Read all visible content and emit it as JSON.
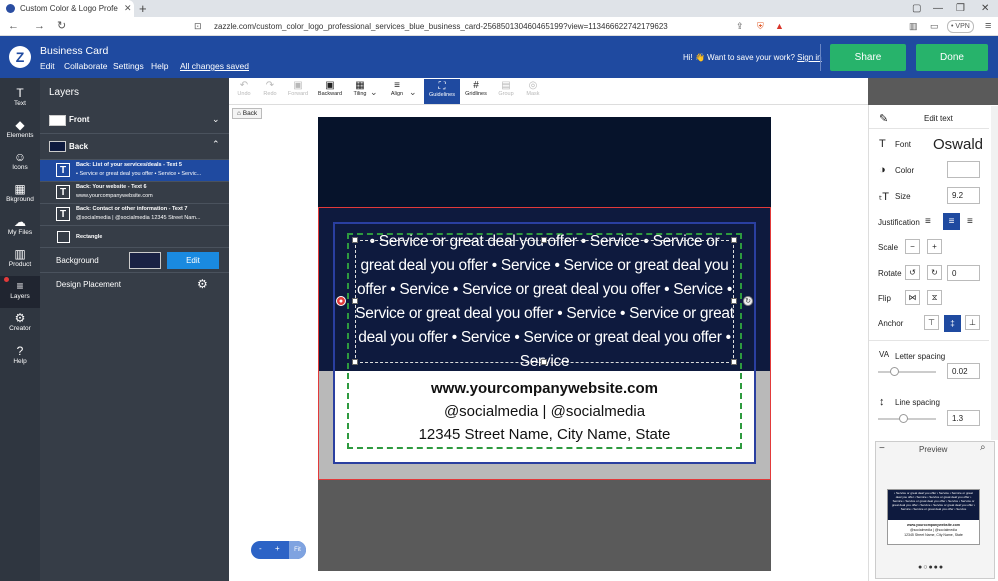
{
  "browser": {
    "tab_title": "Custom Color & Logo Professio...",
    "url": "zazzle.com/custom_color_logo_professional_services_blue_business_card-256850130460465199?view=113466622742179623",
    "vpn": "VPN"
  },
  "header": {
    "title": "Business Card",
    "menu": [
      "Edit",
      "Collaborate",
      "Settings",
      "Help"
    ],
    "saved": "All changes saved",
    "save_prompt": "Hi! 👋 Want to save your work?",
    "sign_in": "Sign in",
    "share": "Share",
    "done": "Done"
  },
  "rail": [
    {
      "label": "Text",
      "icon": "T"
    },
    {
      "label": "Elements",
      "icon": "◆"
    },
    {
      "label": "Icons",
      "icon": "☺"
    },
    {
      "label": "Bkground",
      "icon": "▦"
    },
    {
      "label": "My Files",
      "icon": "☁"
    },
    {
      "label": "Product",
      "icon": "▥"
    },
    {
      "label": "Layers",
      "icon": "≡"
    },
    {
      "label": "Creator",
      "icon": "⚙"
    },
    {
      "label": "Help",
      "icon": "?"
    }
  ],
  "layers": {
    "title": "Layers",
    "front": "Front",
    "back": "Back",
    "items": [
      {
        "title": "Back: List of your services/deals - Text 5",
        "sub": "• Service or great deal you offer • Service • Servic..."
      },
      {
        "title": "Back: Your website - Text 6",
        "sub": "www.yourcompanywebsite.com"
      },
      {
        "title": "Back: Contact or other information - Text 7",
        "sub": "@socialmedia | @socialmedia 12345 Street Nam..."
      },
      {
        "title": "Rectangle",
        "sub": ""
      }
    ],
    "background_label": "Background",
    "edit": "Edit",
    "design_placement": "Design Placement"
  },
  "toolbar": [
    {
      "label": "Undo",
      "icon": "↶",
      "disabled": true
    },
    {
      "label": "Redo",
      "icon": "↷",
      "disabled": true
    },
    {
      "label": "Forward",
      "icon": "▣",
      "disabled": true
    },
    {
      "label": "Backward",
      "icon": "▣",
      "disabled": false
    },
    {
      "label": "Tiling",
      "icon": "▦",
      "disabled": false
    },
    {
      "label": "Align",
      "icon": "≡",
      "disabled": false
    },
    {
      "label": "Guidelines",
      "icon": "⛶",
      "disabled": false
    },
    {
      "label": "Gridlines",
      "icon": "#",
      "disabled": false
    },
    {
      "label": "Group",
      "icon": "▤",
      "disabled": true
    },
    {
      "label": "Mask",
      "icon": "◎",
      "disabled": true
    }
  ],
  "back_button": "Back",
  "card": {
    "services": "• Service or great deal you offer • Service • Service or great deal you offer • Service • Service or great deal you offer • Service • Service or great deal you offer • Service • Service or great deal you offer • Service • Service or great deal you offer • Service • Service or great deal you offer • Service",
    "website": "www.yourcompanywebsite.com",
    "social": "@socialmedia | @socialmedia",
    "address": "12345 Street Name, City Name, State"
  },
  "panel": {
    "edit_text": "Edit text",
    "font_label": "Font",
    "font_value": "Oswald",
    "color_label": "Color",
    "size_label": "Size",
    "size_value": "9.2",
    "justification_label": "Justification",
    "scale_label": "Scale",
    "rotate_label": "Rotate",
    "rotate_value": "0",
    "flip_label": "Flip",
    "anchor_label": "Anchor",
    "letter_spacing_label": "Letter spacing",
    "letter_spacing_value": "0.02",
    "line_spacing_label": "Line spacing",
    "line_spacing_value": "1.3"
  },
  "preview": {
    "title": "Preview"
  },
  "zoom": {
    "minus": "-",
    "plus": "+",
    "fit": "Fit"
  },
  "colors": {
    "brand": "#1f4aa0",
    "green": "#27b36b",
    "card_navy": "#0e1a3e"
  }
}
